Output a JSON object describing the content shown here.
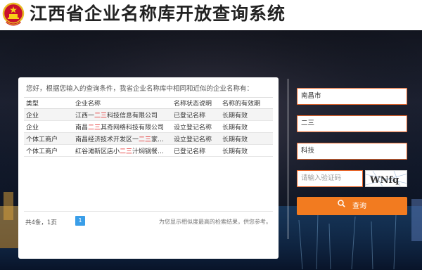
{
  "header": {
    "title": "江西省企业名称库开放查询系统"
  },
  "results": {
    "intro": "您好，根据您输入的查询条件，我省企业名称库中相同和近似的企业名称有：",
    "columns": [
      "类型",
      "企业名称",
      "名称状态说明",
      "名称的有效期"
    ],
    "rows": [
      {
        "type": "企业",
        "name_pre": "江西一",
        "name_hl": "二三",
        "name_post": "科技信息有限公司",
        "status": "已登记名称",
        "validity": "长期有效"
      },
      {
        "type": "企业",
        "name_pre": "南昌",
        "name_hl": "二三",
        "name_post": "其奇网络科技有限公司",
        "status": "设立登记名称",
        "validity": "长期有效"
      },
      {
        "type": "个体工商户",
        "name_pre": "南昌经济技术开发区一",
        "name_hl": "二三",
        "name_post": "家…",
        "status": "设立登记名称",
        "validity": "长期有效"
      },
      {
        "type": "个体工商户",
        "name_pre": "红谷滩新区店小",
        "name_hl": "二三",
        "name_post": "汁焖锅餐…",
        "status": "已登记名称",
        "validity": "长期有效"
      }
    ],
    "pager": {
      "info": "共4条，1页",
      "current_page": "1",
      "note": "为您显示相似度最高的检索结果，供您参考。"
    }
  },
  "search_form": {
    "region_value": "南昌市",
    "keyword_value": "二三",
    "industry_value": "科技",
    "captcha_placeholder": "请输入验证码",
    "captcha_text": "WNfq",
    "search_label": "查询"
  },
  "colors": {
    "accent": "#f27b20",
    "field_border": "#e8662a",
    "highlight": "#e02020",
    "page_active": "#3a9ee8"
  },
  "icons": [
    "national-emblem-icon",
    "search-icon"
  ]
}
